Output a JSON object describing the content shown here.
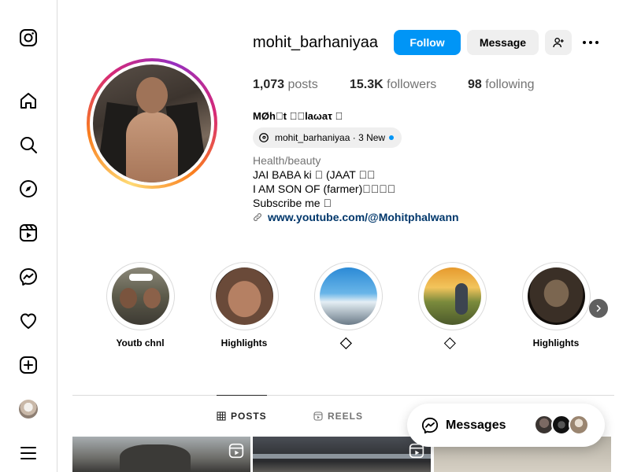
{
  "sidebar": {
    "items": [
      {
        "name": "instagram-logo-icon"
      },
      {
        "name": "home-icon"
      },
      {
        "name": "search-icon"
      },
      {
        "name": "explore-icon"
      },
      {
        "name": "reels-icon"
      },
      {
        "name": "messenger-icon"
      },
      {
        "name": "notifications-heart-icon"
      },
      {
        "name": "create-plus-icon"
      },
      {
        "name": "profile-avatar"
      },
      {
        "name": "more-menu-icon"
      }
    ]
  },
  "profile": {
    "username": "mohit_barhaniyaa",
    "follow_label": "Follow",
    "message_label": "Message",
    "stats": {
      "posts_count": "1,073",
      "posts_label": "posts",
      "followers_count": "15.3K",
      "followers_label": "followers",
      "following_count": "98",
      "following_label": "following"
    },
    "full_name": "MØh⃟t ⃟⃟laωaτ ⃟",
    "threads": {
      "handle": "mohit_barhaniyaa",
      "new_text": "· 3 New"
    },
    "category": "Health/beauty",
    "bio": [
      "JAI BABA ki ⃟ (JAAT ⃟⃟",
      "I AM SON OF (farmer)⃟⃟⃟⃟",
      "Subscribe me ⃟"
    ],
    "link": "www.youtube.com/@Mohitphalwann"
  },
  "highlights": [
    {
      "label": "Youtb chnl"
    },
    {
      "label": "Highlights"
    },
    {
      "label": "⃟⃟"
    },
    {
      "label": "⃟"
    },
    {
      "label": "Highlights"
    }
  ],
  "tabs": {
    "posts_label": "POSTS",
    "reels_label": "REELS"
  },
  "messages": {
    "label": "Messages"
  },
  "colors": {
    "follow_button": "#0095f6",
    "secondary_button": "#efefef",
    "link": "#00376b",
    "muted_text": "#737373",
    "border": "#dbdbdb"
  }
}
